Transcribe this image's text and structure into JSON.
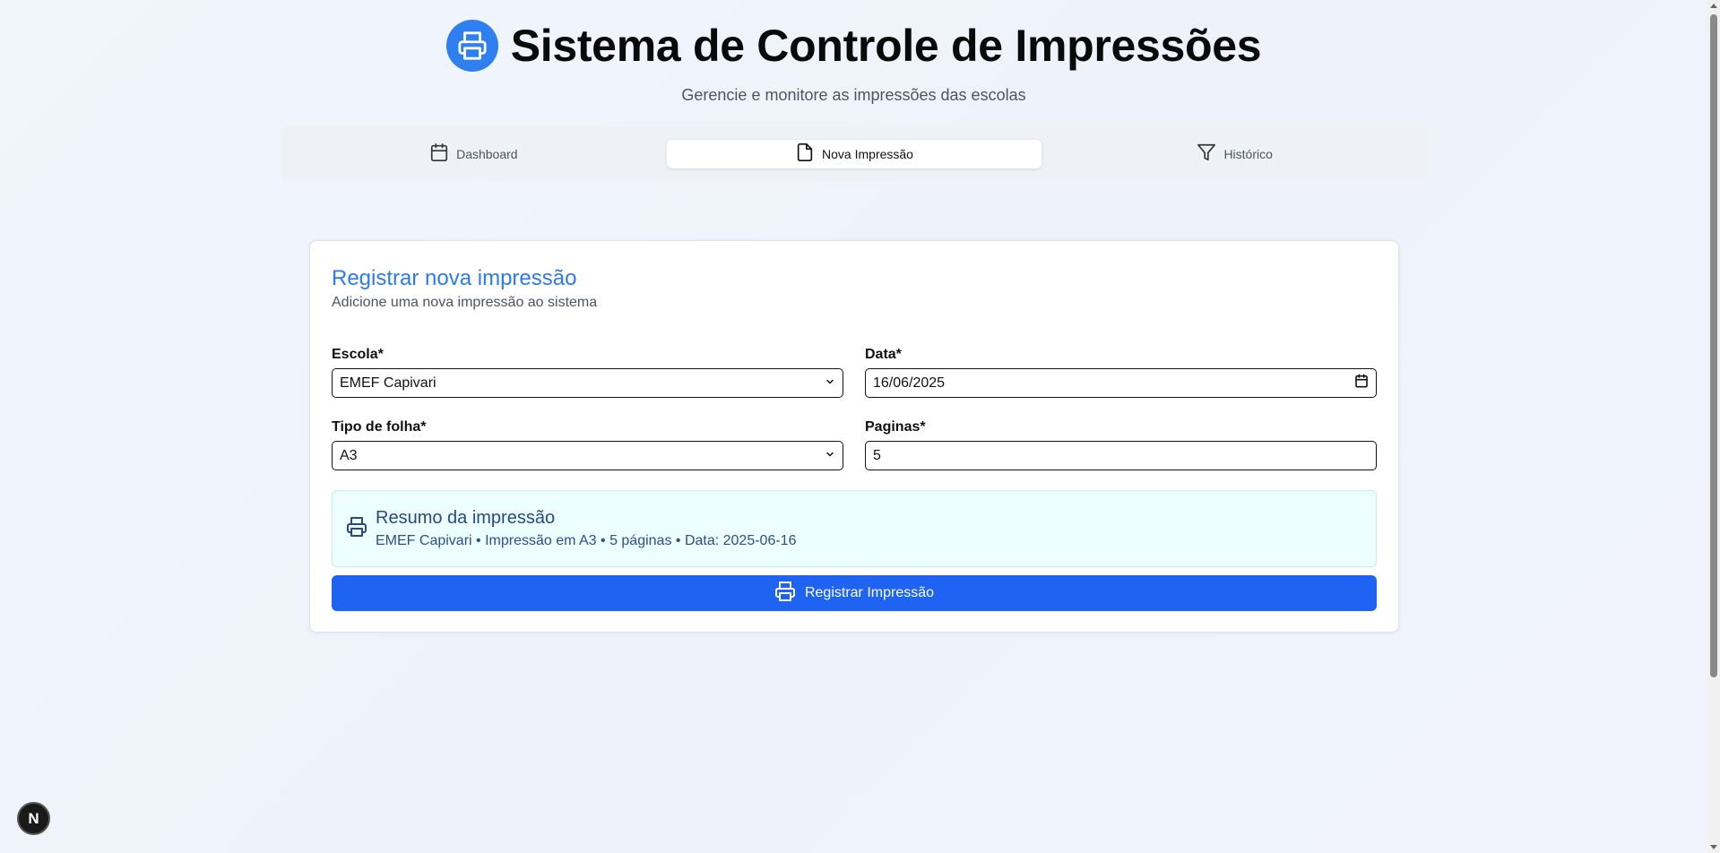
{
  "header": {
    "title": "Sistema de Controle de Impressões",
    "subtitle": "Gerencie e monitore as impressões das escolas",
    "logo_icon": "printer-icon",
    "accent": "#2f7ff0"
  },
  "tabs": [
    {
      "label": "Dashboard",
      "icon": "calendar-icon",
      "active": false
    },
    {
      "label": "Nova Impressão",
      "icon": "file-icon",
      "active": true
    },
    {
      "label": "Histórico",
      "icon": "filter-icon",
      "active": false
    }
  ],
  "form": {
    "title": "Registrar nova impressão",
    "description": "Adicione uma nova impressão ao sistema",
    "school": {
      "label": "Escola*",
      "value": "EMEF Capivari"
    },
    "date": {
      "label": "Data*",
      "value": "16/06/2025"
    },
    "paper": {
      "label": "Tipo de folha*",
      "value": "A3"
    },
    "pages": {
      "label": "Paginas*",
      "value": "5"
    },
    "summary": {
      "title": "Resumo da impressão",
      "text": "EMEF Capivari • Impressão em A3 • 5 páginas • Data: 2025-06-16"
    },
    "submit_label": "Registrar Impressão",
    "submit_color": "#1e63f2"
  },
  "badge": {
    "label": "N"
  }
}
